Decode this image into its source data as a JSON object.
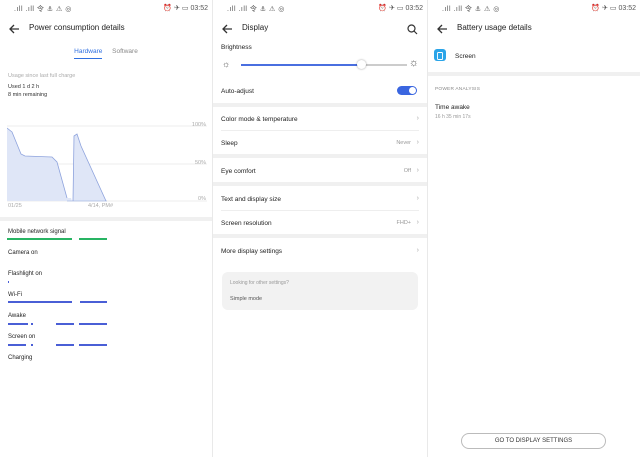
{
  "status": {
    "signal": ".ıll .ıll 令 ⚓ ⚠ ◎",
    "icons": "⏰ ✈ ▭",
    "battery": "53",
    "time": "03:52"
  },
  "p1": {
    "title": "Power consumption details",
    "tabs": [
      {
        "label": "Hardware",
        "active": true
      },
      {
        "label": "Software",
        "active": false
      }
    ],
    "since": "Usage since last full charge",
    "used": "Used 1 d 2 h",
    "remaining": "8 min remaining",
    "chart_labels": {
      "y100": "100%",
      "y50": "50%",
      "y0": "0%",
      "x_start": "01/25",
      "x_end": "4/14, PM#"
    },
    "rows": [
      {
        "label": "Mobile network signal",
        "color": "#28b463"
      },
      {
        "label": "Camera on",
        "color": "#4a5fd6"
      },
      {
        "label": "Flashlight on",
        "color": "#4a5fd6"
      },
      {
        "label": "Wi-Fi",
        "color": "#4a5fd6"
      },
      {
        "label": "Awake",
        "color": "#4a5fd6"
      },
      {
        "label": "Screen on",
        "color": "#4a5fd6"
      },
      {
        "label": "Charging",
        "color": "#4a5fd6"
      }
    ]
  },
  "p2": {
    "title": "Display",
    "brightness_label": "Brightness",
    "brightness_level": 0.72,
    "auto_adjust": "Auto-adjust",
    "color_mode": "Color mode & temperature",
    "sleep": "Sleep",
    "sleep_value": "Never",
    "eye_comfort": "Eye comfort",
    "eye_value": "Off",
    "text_size": "Text and display size",
    "resolution": "Screen resolution",
    "resolution_value": "FHD+",
    "more": "More display settings",
    "hint_q": "Looking for other settings?",
    "hint_link": "Simple mode"
  },
  "p3": {
    "title": "Battery usage details",
    "screen": "Screen",
    "analysis": "POWER ANALYSIS",
    "awake_label": "Time awake",
    "awake_value": "16 h 35 min 17s",
    "button": "GO TO DISPLAY SETTINGS"
  }
}
